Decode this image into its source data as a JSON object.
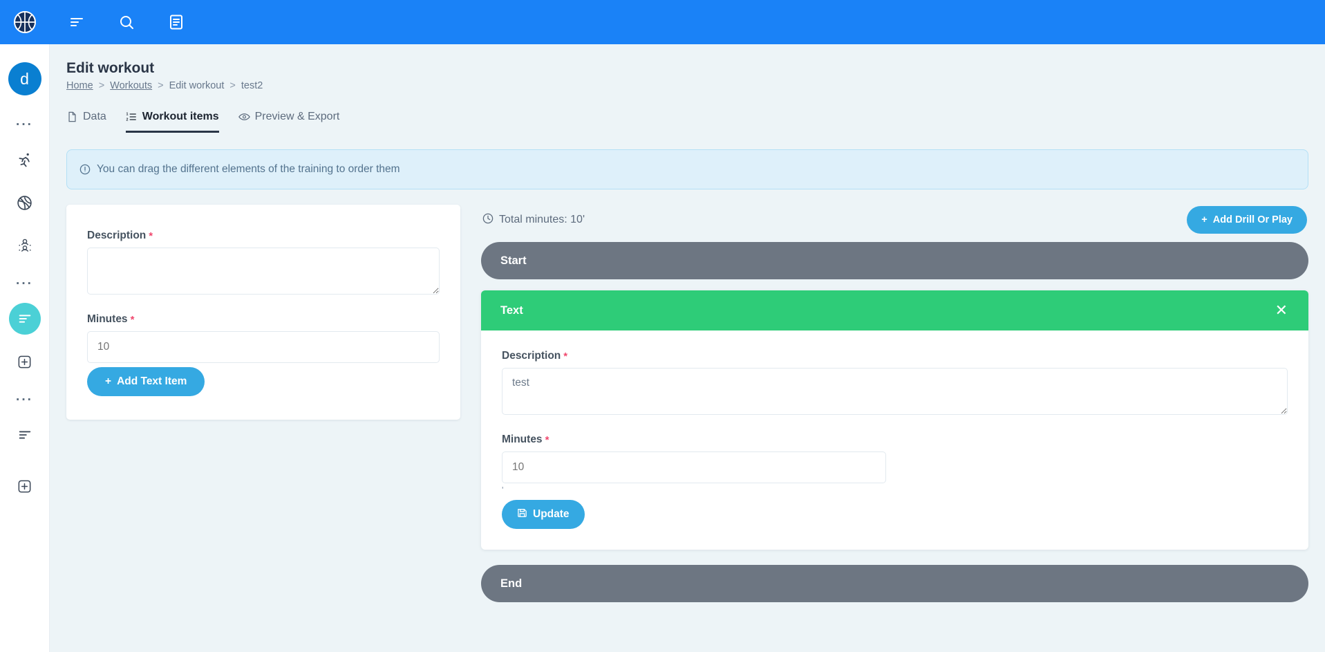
{
  "topbar": {
    "logo_icon": "basketball-logo-icon",
    "icons": [
      {
        "name": "menu-list-icon",
        "glyph": "menu"
      },
      {
        "name": "search-icon",
        "glyph": "search"
      },
      {
        "name": "book-icon",
        "glyph": "book"
      }
    ],
    "bg_color": "#1a82f7"
  },
  "sidebar": {
    "avatar_letter": "d",
    "avatar_color": "#0a7fd1",
    "active_color": "#4bd0d6",
    "items": [
      {
        "name": "sidebar-dots-1",
        "icon": "ellipsis-icon",
        "label": "···",
        "active": false
      },
      {
        "name": "sidebar-item-run",
        "icon": "running-icon",
        "label": "",
        "active": false
      },
      {
        "name": "sidebar-item-ball",
        "icon": "basketball-icon",
        "label": "",
        "active": false
      },
      {
        "name": "sidebar-item-team",
        "icon": "users-icon",
        "label": "",
        "active": false
      },
      {
        "name": "sidebar-dots-2",
        "icon": "ellipsis-icon",
        "label": "···",
        "active": false
      },
      {
        "name": "sidebar-item-workouts",
        "icon": "list-icon",
        "label": "",
        "active": true
      },
      {
        "name": "sidebar-item-add-workout",
        "icon": "plus-box-icon",
        "label": "",
        "active": false
      },
      {
        "name": "sidebar-dots-3",
        "icon": "ellipsis-icon",
        "label": "···",
        "active": false
      },
      {
        "name": "sidebar-item-list2",
        "icon": "list-icon",
        "label": "",
        "active": false
      },
      {
        "name": "sidebar-item-add2",
        "icon": "plus-box-icon",
        "label": "",
        "active": false
      }
    ]
  },
  "page": {
    "title": "Edit workout",
    "breadcrumb": [
      {
        "label": "Home",
        "link": true
      },
      {
        "label": "Workouts",
        "link": true
      },
      {
        "label": "Edit workout",
        "link": false
      },
      {
        "label": "test2",
        "link": false
      }
    ],
    "breadcrumb_separator": ">"
  },
  "tabs": [
    {
      "label": "Data",
      "icon": "file-icon",
      "active": false
    },
    {
      "label": "Workout items",
      "icon": "ordered-list-icon",
      "active": true
    },
    {
      "label": "Preview & Export",
      "icon": "eye-icon",
      "active": false
    }
  ],
  "banner": {
    "icon": "info-circle-icon",
    "text": "You can drag the different elements of the training to order them"
  },
  "left_form": {
    "description_label": "Description",
    "description_value": "",
    "description_placeholder": "",
    "minutes_label": "Minutes",
    "minutes_value": "",
    "minutes_placeholder": "10",
    "required_mark": "*",
    "add_text_item_label": "Add Text Item",
    "add_text_item_icon": "plus-icon"
  },
  "right_panel": {
    "total_minutes_label": "Total minutes: 10'",
    "total_minutes_icon": "clock-icon",
    "add_drill_label": "Add Drill Or Play",
    "add_drill_icon": "plus-icon",
    "start_bar_label": "Start",
    "end_bar_label": "End",
    "bar_color": "#6d7682"
  },
  "item_card": {
    "header_title": "Text",
    "header_color": "#2ecc78",
    "close_icon": "close-icon",
    "description_label": "Description",
    "description_value": "test",
    "description_placeholder": "",
    "minutes_label": "Minutes",
    "minutes_value": "",
    "minutes_placeholder": "10",
    "required_mark": "*",
    "apostrophe": "'",
    "update_label": "Update",
    "update_icon": "save-icon"
  }
}
